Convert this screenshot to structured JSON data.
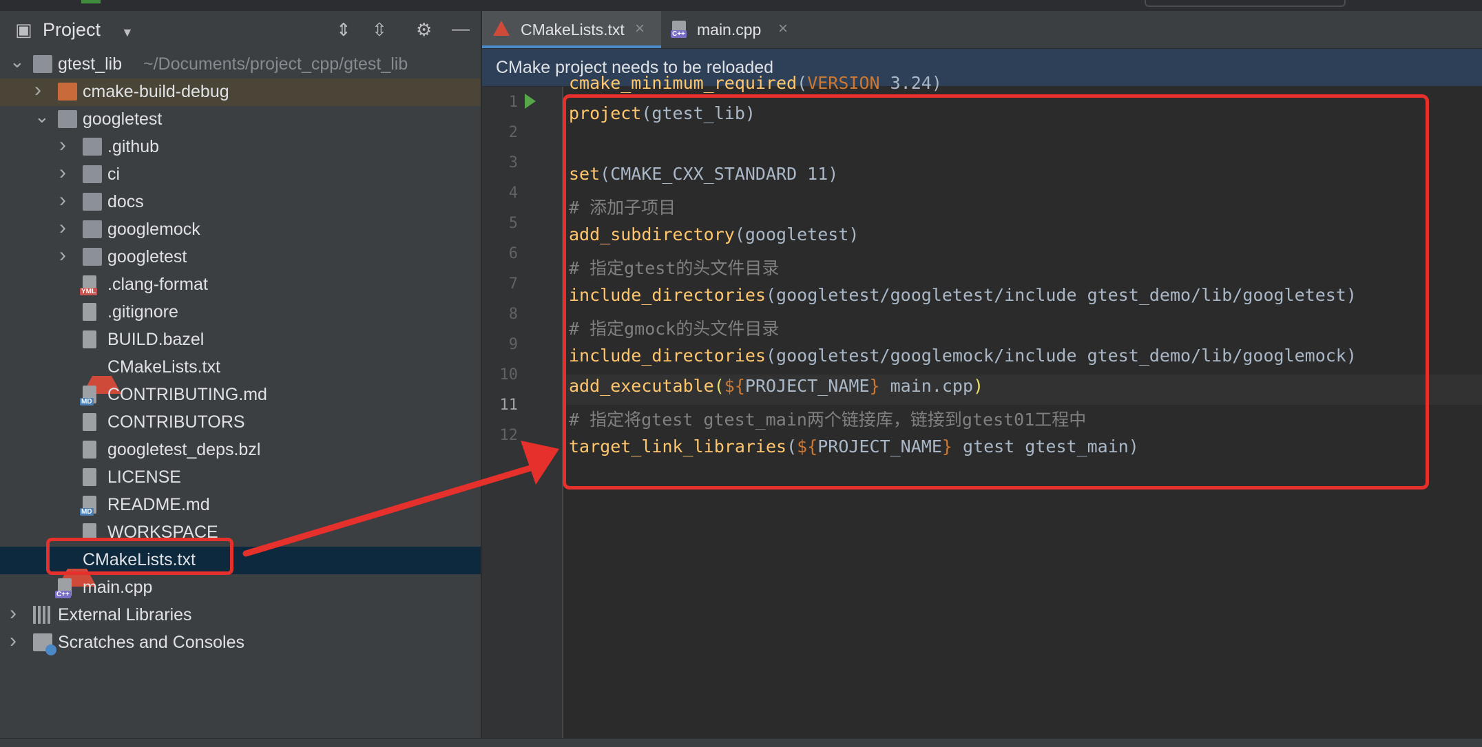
{
  "project_panel": {
    "title": "Project",
    "tree": [
      {
        "label": "gtest_lib",
        "path": "~/Documents/project_cpp/gtest_lib",
        "icon": "folder-icon",
        "arrow": "expanded"
      },
      {
        "label": "cmake-build-debug",
        "icon": "folder-orange-icon",
        "arrow": "collapsed"
      },
      {
        "label": "googletest",
        "icon": "folder-icon",
        "arrow": "expanded"
      },
      {
        "label": ".github",
        "icon": "folder-icon",
        "arrow": "collapsed"
      },
      {
        "label": "ci",
        "icon": "folder-icon",
        "arrow": "collapsed"
      },
      {
        "label": "docs",
        "icon": "folder-icon",
        "arrow": "collapsed"
      },
      {
        "label": "googlemock",
        "icon": "folder-icon",
        "arrow": "collapsed"
      },
      {
        "label": "googletest",
        "icon": "folder-icon",
        "arrow": "collapsed"
      },
      {
        "label": ".clang-format",
        "icon": "yml-file-icon",
        "badge": "YML"
      },
      {
        "label": ".gitignore",
        "icon": "gitignore-file-icon"
      },
      {
        "label": "BUILD.bazel",
        "icon": "text-file-icon"
      },
      {
        "label": "CMakeLists.txt",
        "icon": "cmake-icon"
      },
      {
        "label": "CONTRIBUTING.md",
        "icon": "markdown-file-icon",
        "badge": "MD"
      },
      {
        "label": "CONTRIBUTORS",
        "icon": "text-file-icon"
      },
      {
        "label": "googletest_deps.bzl",
        "icon": "text-file-icon"
      },
      {
        "label": "LICENSE",
        "icon": "text-file-icon"
      },
      {
        "label": "README.md",
        "icon": "markdown-file-icon",
        "badge": "MD"
      },
      {
        "label": "WORKSPACE",
        "icon": "text-file-icon"
      },
      {
        "label": "CMakeLists.txt",
        "icon": "cmake-icon",
        "selected": true
      },
      {
        "label": "main.cpp",
        "icon": "cpp-file-icon",
        "badge": "C++"
      },
      {
        "label": "External Libraries",
        "icon": "libraries-icon",
        "arrow": "collapsed"
      },
      {
        "label": "Scratches and Consoles",
        "icon": "scratches-icon",
        "arrow": "collapsed"
      }
    ]
  },
  "tabs": [
    {
      "label": "CMakeLists.txt",
      "icon": "cmake-icon",
      "active": true
    },
    {
      "label": "main.cpp",
      "icon": "cpp-file-icon",
      "badge": "C++",
      "active": false
    }
  ],
  "banner": "CMake project needs to be reloaded",
  "editor": {
    "current_line": 11,
    "line_numbers": [
      "1",
      "2",
      "3",
      "4",
      "5",
      "6",
      "7",
      "8",
      "9",
      "10",
      "11",
      "12"
    ],
    "lines": [
      "cmake_minimum_required(VERSION 3.24)",
      "project(gtest_lib)",
      "",
      "set(CMAKE_CXX_STANDARD 11)",
      "# 添加子项目",
      "add_subdirectory(googletest)",
      "# 指定gtest的头文件目录",
      "include_directories(googletest/googletest/include gtest_demo/lib/googletest)",
      "# 指定gmock的头文件目录",
      "include_directories(googletest/googlemock/include gtest_demo/lib/googlemock)",
      "add_executable(${PROJECT_NAME} main.cpp)",
      "# 指定将gtest gtest_main两个链接库，链接到gtest01工程中",
      "target_link_libraries(${PROJECT_NAME} gtest gtest_main)"
    ]
  },
  "annotation_color": "#e5302b"
}
